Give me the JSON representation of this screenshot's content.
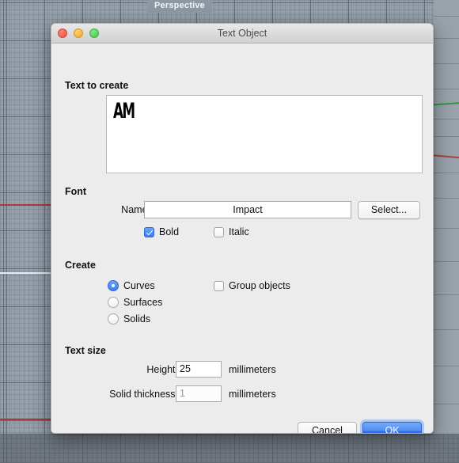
{
  "viewport": {
    "tab_label": "Perspective"
  },
  "dialog": {
    "title": "Text Object",
    "window_controls": {
      "close": "close-icon",
      "minimize": "minimize-icon",
      "zoom": "zoom-icon"
    },
    "text_to_create": {
      "section_label": "Text to create",
      "value": "AM",
      "placeholder": ""
    },
    "font": {
      "section_label": "Font",
      "name_label": "Name:",
      "name_value": "Impact",
      "select_button": "Select...",
      "bold_label": "Bold",
      "bold_checked": true,
      "italic_label": "Italic",
      "italic_checked": false
    },
    "create": {
      "section_label": "Create",
      "options": [
        {
          "label": "Curves",
          "selected": true
        },
        {
          "label": "Surfaces",
          "selected": false
        },
        {
          "label": "Solids",
          "selected": false
        }
      ],
      "group_objects_label": "Group objects",
      "group_objects_checked": false
    },
    "text_size": {
      "section_label": "Text size",
      "height_label": "Height:",
      "height_value": "25",
      "height_unit": "millimeters",
      "thickness_label": "Solid thickness:",
      "thickness_value": "1",
      "thickness_unit": "millimeters",
      "thickness_disabled": true
    },
    "buttons": {
      "cancel": "Cancel",
      "ok": "OK",
      "default_button": "OK"
    }
  },
  "colors": {
    "accent_blue": "#3c7ef0",
    "ok_button_blue": "#2f6fec",
    "dialog_background": "#ececec",
    "viewport_gray": "#96a0ab",
    "axis_x_red": "#ab3a3a",
    "axis_y_green": "#2f9b3e",
    "close_red": "#e8564a",
    "minimize_yellow": "#eba92e",
    "zoom_green": "#4cc44f"
  }
}
